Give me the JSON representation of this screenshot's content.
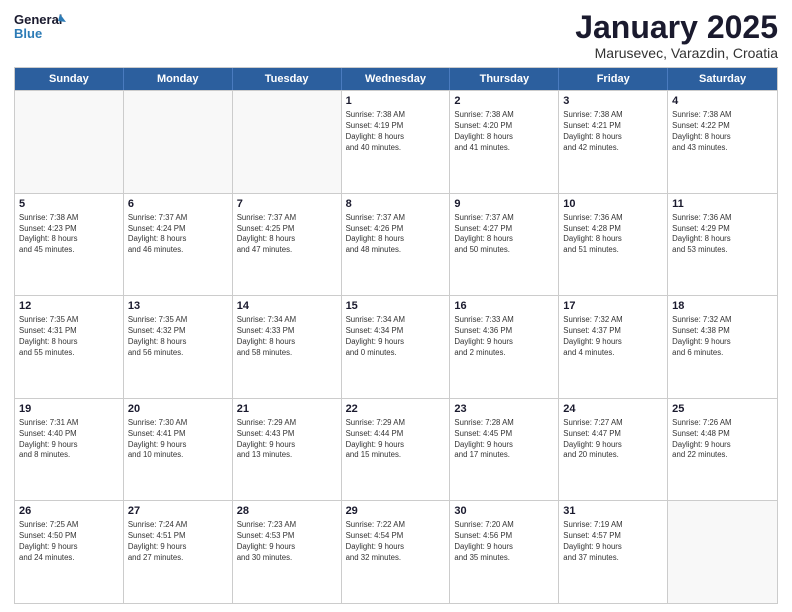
{
  "logo": {
    "line1": "General",
    "line2": "Blue"
  },
  "title": "January 2025",
  "subtitle": "Marusevec, Varazdin, Croatia",
  "header_days": [
    "Sunday",
    "Monday",
    "Tuesday",
    "Wednesday",
    "Thursday",
    "Friday",
    "Saturday"
  ],
  "weeks": [
    [
      {
        "day": "",
        "info": ""
      },
      {
        "day": "",
        "info": ""
      },
      {
        "day": "",
        "info": ""
      },
      {
        "day": "1",
        "info": "Sunrise: 7:38 AM\nSunset: 4:19 PM\nDaylight: 8 hours\nand 40 minutes."
      },
      {
        "day": "2",
        "info": "Sunrise: 7:38 AM\nSunset: 4:20 PM\nDaylight: 8 hours\nand 41 minutes."
      },
      {
        "day": "3",
        "info": "Sunrise: 7:38 AM\nSunset: 4:21 PM\nDaylight: 8 hours\nand 42 minutes."
      },
      {
        "day": "4",
        "info": "Sunrise: 7:38 AM\nSunset: 4:22 PM\nDaylight: 8 hours\nand 43 minutes."
      }
    ],
    [
      {
        "day": "5",
        "info": "Sunrise: 7:38 AM\nSunset: 4:23 PM\nDaylight: 8 hours\nand 45 minutes."
      },
      {
        "day": "6",
        "info": "Sunrise: 7:37 AM\nSunset: 4:24 PM\nDaylight: 8 hours\nand 46 minutes."
      },
      {
        "day": "7",
        "info": "Sunrise: 7:37 AM\nSunset: 4:25 PM\nDaylight: 8 hours\nand 47 minutes."
      },
      {
        "day": "8",
        "info": "Sunrise: 7:37 AM\nSunset: 4:26 PM\nDaylight: 8 hours\nand 48 minutes."
      },
      {
        "day": "9",
        "info": "Sunrise: 7:37 AM\nSunset: 4:27 PM\nDaylight: 8 hours\nand 50 minutes."
      },
      {
        "day": "10",
        "info": "Sunrise: 7:36 AM\nSunset: 4:28 PM\nDaylight: 8 hours\nand 51 minutes."
      },
      {
        "day": "11",
        "info": "Sunrise: 7:36 AM\nSunset: 4:29 PM\nDaylight: 8 hours\nand 53 minutes."
      }
    ],
    [
      {
        "day": "12",
        "info": "Sunrise: 7:35 AM\nSunset: 4:31 PM\nDaylight: 8 hours\nand 55 minutes."
      },
      {
        "day": "13",
        "info": "Sunrise: 7:35 AM\nSunset: 4:32 PM\nDaylight: 8 hours\nand 56 minutes."
      },
      {
        "day": "14",
        "info": "Sunrise: 7:34 AM\nSunset: 4:33 PM\nDaylight: 8 hours\nand 58 minutes."
      },
      {
        "day": "15",
        "info": "Sunrise: 7:34 AM\nSunset: 4:34 PM\nDaylight: 9 hours\nand 0 minutes."
      },
      {
        "day": "16",
        "info": "Sunrise: 7:33 AM\nSunset: 4:36 PM\nDaylight: 9 hours\nand 2 minutes."
      },
      {
        "day": "17",
        "info": "Sunrise: 7:32 AM\nSunset: 4:37 PM\nDaylight: 9 hours\nand 4 minutes."
      },
      {
        "day": "18",
        "info": "Sunrise: 7:32 AM\nSunset: 4:38 PM\nDaylight: 9 hours\nand 6 minutes."
      }
    ],
    [
      {
        "day": "19",
        "info": "Sunrise: 7:31 AM\nSunset: 4:40 PM\nDaylight: 9 hours\nand 8 minutes."
      },
      {
        "day": "20",
        "info": "Sunrise: 7:30 AM\nSunset: 4:41 PM\nDaylight: 9 hours\nand 10 minutes."
      },
      {
        "day": "21",
        "info": "Sunrise: 7:29 AM\nSunset: 4:43 PM\nDaylight: 9 hours\nand 13 minutes."
      },
      {
        "day": "22",
        "info": "Sunrise: 7:29 AM\nSunset: 4:44 PM\nDaylight: 9 hours\nand 15 minutes."
      },
      {
        "day": "23",
        "info": "Sunrise: 7:28 AM\nSunset: 4:45 PM\nDaylight: 9 hours\nand 17 minutes."
      },
      {
        "day": "24",
        "info": "Sunrise: 7:27 AM\nSunset: 4:47 PM\nDaylight: 9 hours\nand 20 minutes."
      },
      {
        "day": "25",
        "info": "Sunrise: 7:26 AM\nSunset: 4:48 PM\nDaylight: 9 hours\nand 22 minutes."
      }
    ],
    [
      {
        "day": "26",
        "info": "Sunrise: 7:25 AM\nSunset: 4:50 PM\nDaylight: 9 hours\nand 24 minutes."
      },
      {
        "day": "27",
        "info": "Sunrise: 7:24 AM\nSunset: 4:51 PM\nDaylight: 9 hours\nand 27 minutes."
      },
      {
        "day": "28",
        "info": "Sunrise: 7:23 AM\nSunset: 4:53 PM\nDaylight: 9 hours\nand 30 minutes."
      },
      {
        "day": "29",
        "info": "Sunrise: 7:22 AM\nSunset: 4:54 PM\nDaylight: 9 hours\nand 32 minutes."
      },
      {
        "day": "30",
        "info": "Sunrise: 7:20 AM\nSunset: 4:56 PM\nDaylight: 9 hours\nand 35 minutes."
      },
      {
        "day": "31",
        "info": "Sunrise: 7:19 AM\nSunset: 4:57 PM\nDaylight: 9 hours\nand 37 minutes."
      },
      {
        "day": "",
        "info": ""
      }
    ]
  ]
}
